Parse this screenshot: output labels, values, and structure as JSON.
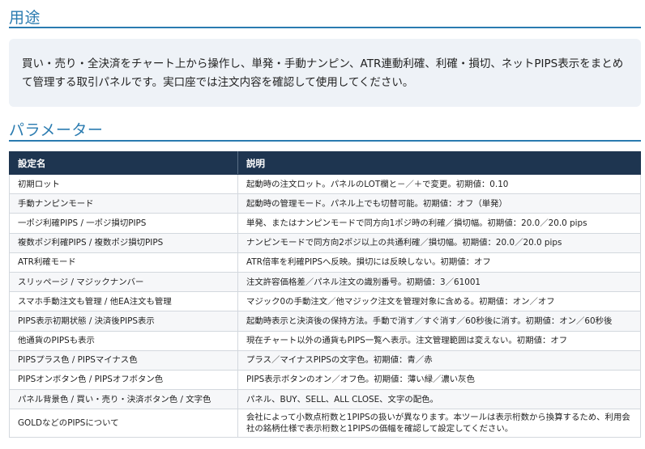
{
  "usage": {
    "title": "用途",
    "text": "買い・売り・全決済をチャート上から操作し、単発・手動ナンピン、ATR連動利確、利確・損切、ネットPIPS表示をまとめて管理する取引パネルです。実口座では注文内容を確認して使用してください。"
  },
  "params": {
    "title": "パラメーター",
    "headers": [
      "設定名",
      "説明"
    ],
    "rows": [
      [
        "初期ロット",
        "起動時の注文ロット。パネルのLOT欄と－／＋で変更。初期値：0.10"
      ],
      [
        "手動ナンピンモード",
        "起動時の管理モード。パネル上でも切替可能。初期値：オフ（単発）"
      ],
      [
        "一ポジ利確PIPS / 一ポジ損切PIPS",
        "単発、またはナンピンモードで同方向1ポジ時の利確／損切幅。初期値：20.0／20.0 pips"
      ],
      [
        "複数ポジ利確PIPS / 複数ポジ損切PIPS",
        "ナンピンモードで同方向2ポジ以上の共通利確／損切幅。初期値：20.0／20.0 pips"
      ],
      [
        "ATR利確モード",
        "ATR倍率を利確PIPSへ反映。損切には反映しない。初期値：オフ"
      ],
      [
        "スリッページ / マジックナンバー",
        "注文許容価格差／パネル注文の識別番号。初期値：3／61001"
      ],
      [
        "スマホ手動注文も管理 / 他EA注文も管理",
        "マジック0の手動注文／他マジック注文を管理対象に含める。初期値：オン／オフ"
      ],
      [
        "PIPS表示初期状態 / 決済後PIPS表示",
        "起動時表示と決済後の保持方法。手動で消す／すぐ消す／60秒後に消す。初期値：オン／60秒後"
      ],
      [
        "他通貨のPIPSも表示",
        "現在チャート以外の通貨もPIPS一覧へ表示。注文管理範囲は変えない。初期値：オフ"
      ],
      [
        "PIPSプラス色 / PIPSマイナス色",
        "プラス／マイナスPIPSの文字色。初期値：青／赤"
      ],
      [
        "PIPSオンボタン色 / PIPSオフボタン色",
        "PIPS表示ボタンのオン／オフ色。初期値：薄い緑／濃い灰色"
      ],
      [
        "パネル背景色 / 買い・売り・決済ボタン色 / 文字色",
        "パネル、BUY、SELL、ALL CLOSE、文字の配色。"
      ],
      [
        "GOLDなどのPIPSについて",
        "会社によって小数点桁数と1PIPSの扱いが異なります。本ツールは表示桁数から換算するため、利用会社の銘柄仕様で表示桁数と1PIPSの価幅を確認して設定してください。"
      ]
    ]
  }
}
